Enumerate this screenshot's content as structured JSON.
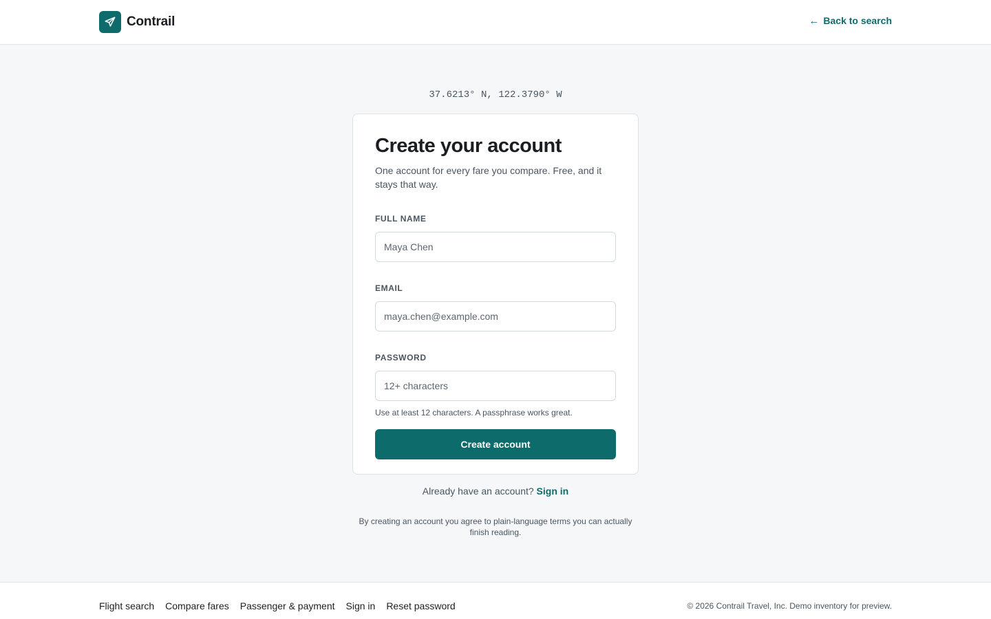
{
  "header": {
    "brand_name": "Contrail",
    "back_link": "Back to search"
  },
  "coordinates": "37.6213° N, 122.3790° W",
  "form": {
    "title": "Create your account",
    "subtitle": "One account for every fare you compare. Free, and it stays that way.",
    "full_name_label": "FULL NAME",
    "full_name_value": "Maya Chen",
    "email_label": "EMAIL",
    "email_value": "maya.chen@example.com",
    "password_label": "PASSWORD",
    "password_placeholder": "12+ characters",
    "password_hint": "Use at least 12 characters. A passphrase works great.",
    "submit_label": "Create account"
  },
  "signin": {
    "prompt": "Already have an account?",
    "link": "Sign in"
  },
  "terms": "By creating an account you agree to plain-language terms you can actually finish reading.",
  "footer": {
    "links": [
      "Flight search",
      "Compare fares",
      "Passenger & payment",
      "Sign in",
      "Reset password"
    ],
    "copyright": "© 2026 Contrail Travel, Inc. Demo inventory for preview."
  },
  "colors": {
    "accent": "#0e6b6b",
    "background": "#f5f7f9"
  },
  "icons": {
    "logo": "plane-icon",
    "back": "arrow-left-icon"
  }
}
